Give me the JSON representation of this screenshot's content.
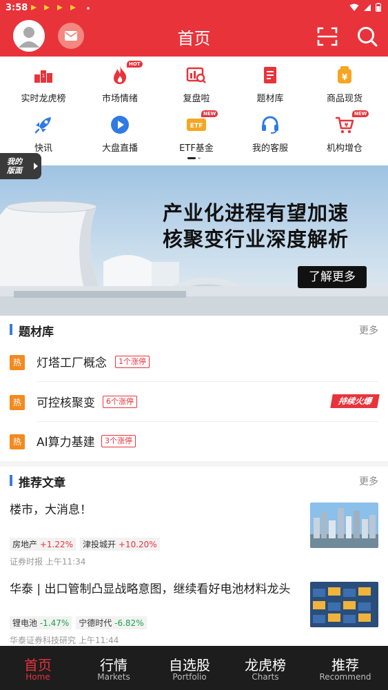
{
  "status_bar": {
    "time": "3:58"
  },
  "header": {
    "title": "首页",
    "avatar_icon": "user-avatar-icon",
    "mail_icon": "mail-icon",
    "scan_icon": "scan-icon",
    "search_icon": "search-icon"
  },
  "quick_grid": {
    "items": [
      {
        "label": "实时龙虎榜",
        "icon": "podium-icon",
        "badge": ""
      },
      {
        "label": "市场情绪",
        "icon": "flame-icon",
        "badge": "HOT"
      },
      {
        "label": "复盘啦",
        "icon": "chart-review-icon",
        "badge": ""
      },
      {
        "label": "题材库",
        "icon": "document-icon",
        "badge": ""
      },
      {
        "label": "商品现货",
        "icon": "yen-bag-icon",
        "badge": ""
      },
      {
        "label": "快讯",
        "icon": "rocket-icon",
        "badge": ""
      },
      {
        "label": "大盘直播",
        "icon": "play-icon",
        "badge": ""
      },
      {
        "label": "ETF基金",
        "icon": "etf-icon",
        "badge": "NEW"
      },
      {
        "label": "我的客服",
        "icon": "headset-icon",
        "badge": ""
      },
      {
        "label": "机构增仓",
        "icon": "cart-yen-icon",
        "badge": "NEW"
      }
    ]
  },
  "my_layout_tab": {
    "line1": "我的",
    "line2": "版面"
  },
  "banner": {
    "line1": "产业化进程有望加速",
    "line2": "核聚变行业深度解析",
    "button": "了解更多"
  },
  "topics": {
    "title": "题材库",
    "more": "更多",
    "items": [
      {
        "hot": "热",
        "name": "灯塔工厂概念",
        "tag": "1个涨停"
      },
      {
        "hot": "热",
        "name": "可控核聚变",
        "tag": "6个涨停",
        "label": "持续火爆"
      },
      {
        "hot": "热",
        "name": "AI算力基建",
        "tag": "3个涨停"
      }
    ]
  },
  "articles": {
    "title": "推荐文章",
    "more": "更多",
    "items": [
      {
        "title": "楼市，大消息！",
        "stocks": [
          {
            "name": "房地产",
            "change": "+1.22%",
            "dir": "up"
          },
          {
            "name": "津投城开",
            "change": "+10.20%",
            "dir": "up"
          }
        ],
        "source": "证券时报",
        "time": "上午11:34"
      },
      {
        "title": "华泰 | 出口管制凸显战略意图，继续看好电池材料龙头",
        "stocks": [
          {
            "name": "锂电池",
            "change": "-1.47%",
            "dir": "down"
          },
          {
            "name": "宁德时代",
            "change": "-6.82%",
            "dir": "down"
          }
        ],
        "source": "华泰证券科技研究",
        "time": "上午11:44"
      }
    ]
  },
  "bottom_nav": {
    "items": [
      {
        "cn": "首页",
        "en": "Home",
        "active": true
      },
      {
        "cn": "行情",
        "en": "Markets",
        "active": false
      },
      {
        "cn": "自选股",
        "en": "Portfolio",
        "active": false
      },
      {
        "cn": "龙虎榜",
        "en": "Charts",
        "active": false
      },
      {
        "cn": "推荐",
        "en": "Recommend",
        "active": false
      }
    ]
  },
  "colors": {
    "brand_red": "#e8333b",
    "up": "#e8333b",
    "down": "#1aa34a",
    "hot": "#f48a1f",
    "accent_blue": "#3b7be0"
  }
}
